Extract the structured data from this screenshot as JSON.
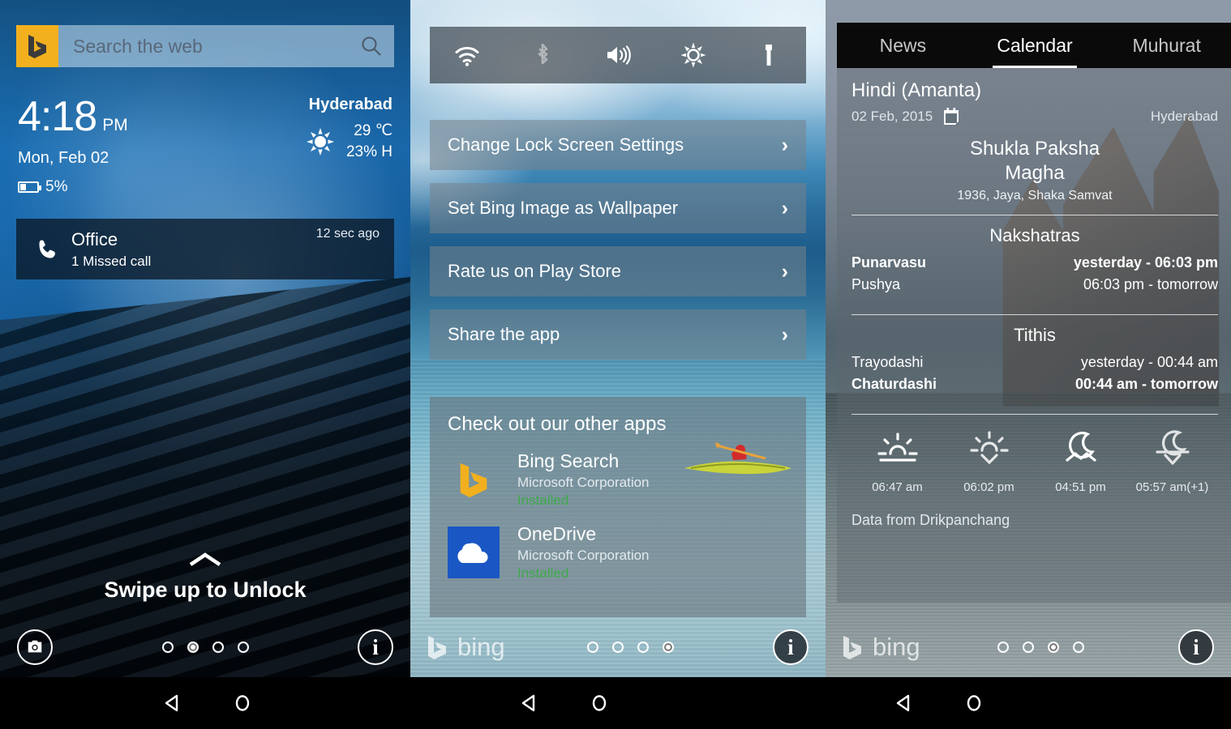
{
  "panel1": {
    "search": {
      "placeholder": "Search the web",
      "bing_icon": "bing-logo-icon",
      "search_icon": "search-icon"
    },
    "clock": {
      "time": "4:18",
      "ampm": "PM",
      "date": "Mon, Feb 02",
      "battery": "5%",
      "battery_icon": "battery-icon"
    },
    "weather": {
      "city": "Hyderabad",
      "icon": "sun-icon",
      "temperature": "29 ℃",
      "humidity": "23% H"
    },
    "notification": {
      "icon": "phone-icon",
      "title": "Office",
      "subtitle": "1 Missed call",
      "time": "12 sec ago"
    },
    "unlock": {
      "chevron_icon": "chevron-up-icon",
      "label": "Swipe up to Unlock"
    },
    "footer": {
      "camera_icon": "camera-icon",
      "info_icon": "info-icon",
      "dots": 4,
      "active_dot": 1
    }
  },
  "panel2": {
    "quick_toggles": [
      {
        "name": "wifi-icon",
        "state": "on"
      },
      {
        "name": "bluetooth-icon",
        "state": "off"
      },
      {
        "name": "volume-icon",
        "state": "on"
      },
      {
        "name": "brightness-icon",
        "state": "on"
      },
      {
        "name": "flashlight-icon",
        "state": "on"
      }
    ],
    "menu": [
      {
        "label": "Change Lock Screen Settings",
        "chevron": "›"
      },
      {
        "label": "Set Bing Image as Wallpaper",
        "chevron": "›"
      },
      {
        "label": "Rate us on Play Store",
        "chevron": "›"
      },
      {
        "label": "Share the app",
        "chevron": "›"
      }
    ],
    "apps_card": {
      "title": "Check out our other apps",
      "apps": [
        {
          "icon": "bing-logo-icon",
          "name": "Bing Search",
          "publisher": "Microsoft Corporation",
          "status": "Installed"
        },
        {
          "icon": "onedrive-icon",
          "name": "OneDrive",
          "publisher": "Microsoft Corporation",
          "status": "Installed"
        }
      ]
    },
    "footer": {
      "brand": "bing",
      "brand_icon": "bing-logo-icon",
      "info_icon": "info-icon",
      "dots": 4,
      "active_dot": 3
    }
  },
  "panel3": {
    "tabs": [
      {
        "label": "News",
        "active": false
      },
      {
        "label": "Calendar",
        "active": true
      },
      {
        "label": "Muhurat",
        "active": false
      }
    ],
    "calendar": {
      "system": "Hindi (Amanta)",
      "date": "02 Feb, 2015",
      "calendar_icon": "calendar-icon",
      "city": "Hyderabad",
      "paksha": "Shukla Paksha",
      "month": "Magha",
      "samvat": "1936, Jaya, Shaka Samvat",
      "nakshatras_title": "Nakshatras",
      "nakshatras": [
        {
          "name": "Punarvasu",
          "span": "yesterday  -  06:03 pm",
          "current": true
        },
        {
          "name": "Pushya",
          "span": "06:03 pm  -  tomorrow",
          "current": false
        }
      ],
      "tithis_title": "Tithis",
      "tithis": [
        {
          "name": "Trayodashi",
          "span": "yesterday  -  00:44 am",
          "current": false
        },
        {
          "name": "Chaturdashi",
          "span": "00:44 am  -  tomorrow",
          "current": true
        }
      ],
      "sun_moon": [
        {
          "icon": "sunrise-icon",
          "time": "06:47 am"
        },
        {
          "icon": "sunset-icon",
          "time": "06:02 pm"
        },
        {
          "icon": "moonrise-icon",
          "time": "04:51 pm"
        },
        {
          "icon": "moonset-icon",
          "time": "05:57 am(+1)"
        }
      ],
      "data_source": "Data from Drikpanchang"
    },
    "footer": {
      "brand": "bing",
      "brand_icon": "bing-logo-icon",
      "info_icon": "info-icon",
      "dots": 4,
      "active_dot": 2
    }
  },
  "navbar": {
    "buttons": [
      {
        "name": "back-button",
        "icon": "triangle-left-icon"
      },
      {
        "name": "home-button",
        "icon": "circle-icon"
      }
    ]
  },
  "colors": {
    "bing_yellow": "#f2b01e",
    "onedrive_blue": "#1a57c4",
    "installed_green": "#3faa4a",
    "tab_bar": "#0a0a0a"
  }
}
